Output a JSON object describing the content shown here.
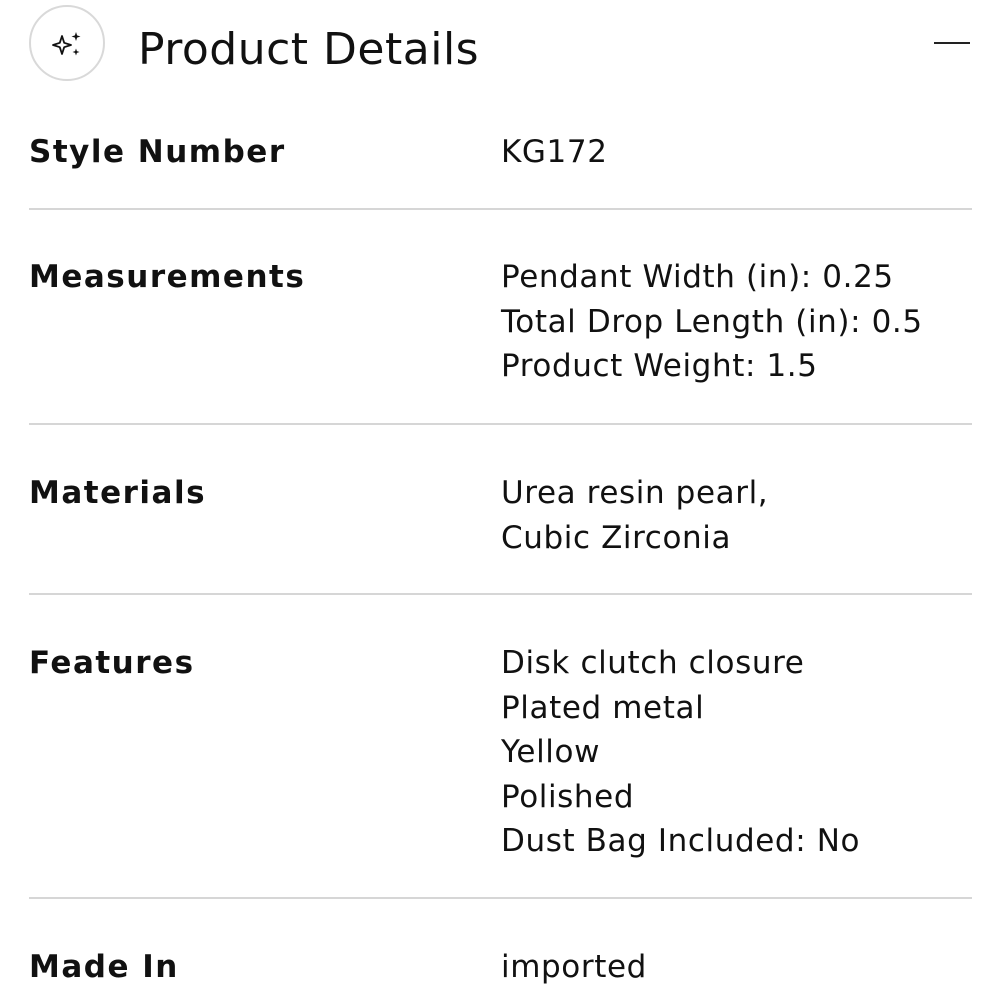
{
  "header": {
    "icon": "sparkle-icon",
    "title": "Product Details",
    "collapse_icon": "minus-icon"
  },
  "details": [
    {
      "label": "Style Number",
      "values": [
        "KG172"
      ]
    },
    {
      "label": "Measurements",
      "values": [
        "Pendant Width (in): 0.25",
        "Total Drop Length (in): 0.5",
        "Product Weight: 1.5"
      ]
    },
    {
      "label": "Materials",
      "values": [
        "Urea resin pearl, Cubic Zirconia"
      ]
    },
    {
      "label": "Features",
      "values": [
        "Disk clutch closure",
        "Plated metal",
        "Yellow",
        "Polished",
        "Dust Bag Included: No"
      ]
    },
    {
      "label": "Made In",
      "values": [
        "imported"
      ]
    }
  ],
  "colors": {
    "text": "#111111",
    "divider": "#d6d6d6",
    "icon_border": "#d9d9d9"
  }
}
